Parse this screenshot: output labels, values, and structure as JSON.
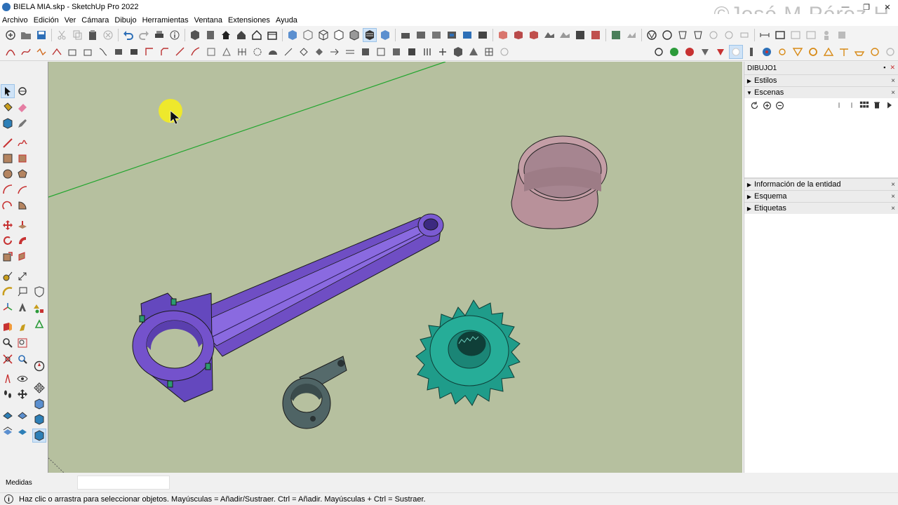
{
  "window": {
    "title": "BIELA MIA.skp - SketchUp Pro 2022",
    "watermark": "©José M Pérez H",
    "controls": {
      "minimize": "—",
      "restore": "❐",
      "close": "✕"
    }
  },
  "menu": [
    "Archivo",
    "Edición",
    "Ver",
    "Cámara",
    "Dibujo",
    "Herramientas",
    "Ventana",
    "Extensiones",
    "Ayuda"
  ],
  "tray": {
    "title": "DIBUJO1",
    "pin": "▪",
    "close": "✕",
    "panels_top": [
      {
        "label": "Estilos",
        "arrow": "▶"
      },
      {
        "label": "Escenas",
        "arrow": "▼"
      }
    ],
    "panels_bottom": [
      {
        "label": "Información de la entidad",
        "arrow": "▶"
      },
      {
        "label": "Esquema",
        "arrow": "▶"
      },
      {
        "label": "Etiquetas",
        "arrow": "▶"
      }
    ],
    "panel_close": "×"
  },
  "measurements": {
    "label": "Medidas",
    "value": ""
  },
  "status": {
    "icon_text": "i",
    "text": "Haz clic o arrastra para seleccionar objetos. Mayúsculas = Añadir/Sustraer. Ctrl = Añadir. Mayúsculas + Ctrl = Sustraer."
  },
  "colors": {
    "viewport_bg": "#b6c09f",
    "con_rod": "#7052c6",
    "gear": "#1f9c8a",
    "bushing": "#c49ea6",
    "clamp": "#4f6465",
    "axis_green": "#22a52e",
    "cursor_highlight": "#f4ec1f"
  }
}
